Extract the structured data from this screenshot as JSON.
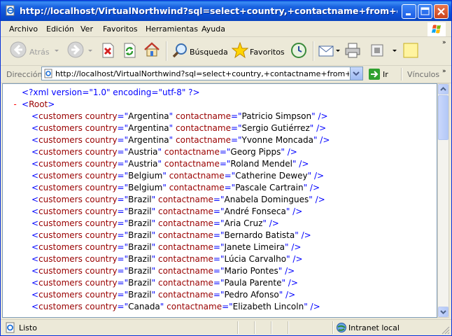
{
  "window": {
    "title": "http://localhost/VirtualNorthwind?sql=select+country,+contactname+from+customer..."
  },
  "menu": {
    "items": [
      "Archivo",
      "Edición",
      "Ver",
      "Favoritos",
      "Herramientas",
      "Ayuda"
    ]
  },
  "toolbar": {
    "back_label": "Atrás",
    "search_label": "Búsqueda",
    "favorites_label": "Favoritos"
  },
  "address": {
    "label": "Dirección",
    "url": "http://localhost/VirtualNorthwind?sql=select+country,+contactname+from+customers+",
    "go_label": "Ir",
    "links_label": "Vínculos"
  },
  "xml": {
    "declaration": "<?xml version=\"1.0\" encoding=\"utf-8\" ?>",
    "collapse_marker": "-",
    "root_tag": "Root",
    "element_tag": "customers",
    "attr_country": "country",
    "attr_contact": "contactname",
    "rows": [
      {
        "country": "Argentina",
        "contactname": "Patricio Simpson"
      },
      {
        "country": "Argentina",
        "contactname": "Sergio Gutiérrez"
      },
      {
        "country": "Argentina",
        "contactname": "Yvonne Moncada"
      },
      {
        "country": "Austria",
        "contactname": "Georg Pipps"
      },
      {
        "country": "Austria",
        "contactname": "Roland Mendel"
      },
      {
        "country": "Belgium",
        "contactname": "Catherine Dewey"
      },
      {
        "country": "Belgium",
        "contactname": "Pascale Cartrain"
      },
      {
        "country": "Brazil",
        "contactname": "Anabela Domingues"
      },
      {
        "country": "Brazil",
        "contactname": "André Fonseca"
      },
      {
        "country": "Brazil",
        "contactname": "Aria Cruz"
      },
      {
        "country": "Brazil",
        "contactname": "Bernardo Batista"
      },
      {
        "country": "Brazil",
        "contactname": "Janete Limeira"
      },
      {
        "country": "Brazil",
        "contactname": "Lúcia Carvalho"
      },
      {
        "country": "Brazil",
        "contactname": "Mario Pontes"
      },
      {
        "country": "Brazil",
        "contactname": "Paula Parente"
      },
      {
        "country": "Brazil",
        "contactname": "Pedro Afonso"
      },
      {
        "country": "Canada",
        "contactname": "Elizabeth Lincoln"
      }
    ]
  },
  "status": {
    "text": "Listo",
    "zone": "Intranet local"
  },
  "colors": {
    "tag": "#990000",
    "punct": "#0000ff",
    "value": "#000000",
    "titlebar": "#0b4ed2"
  }
}
